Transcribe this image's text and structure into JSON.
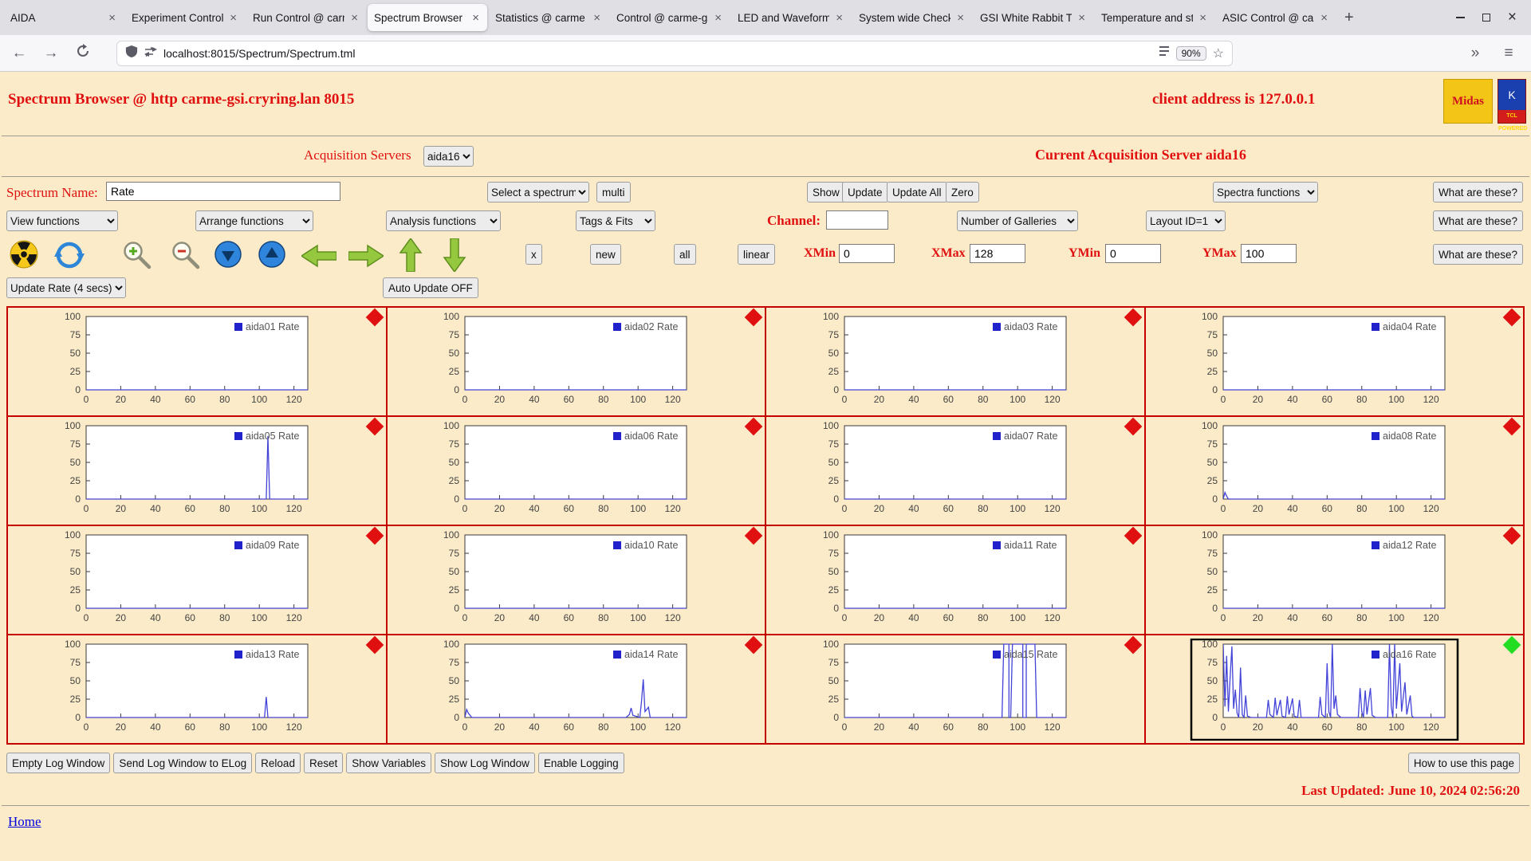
{
  "browser": {
    "tabs": [
      {
        "label": "AIDA",
        "active": false
      },
      {
        "label": "Experiment Control",
        "active": false
      },
      {
        "label": "Run Control @ carm",
        "active": false
      },
      {
        "label": "Spectrum Browser",
        "active": true
      },
      {
        "label": "Statistics @ carme",
        "active": false
      },
      {
        "label": "Control @ carme-gs",
        "active": false
      },
      {
        "label": "LED and Waveform",
        "active": false
      },
      {
        "label": "System wide Check",
        "active": false
      },
      {
        "label": "GSI White Rabbit T",
        "active": false
      },
      {
        "label": "Temperature and st",
        "active": false
      },
      {
        "label": "ASIC Control @ car",
        "active": false
      }
    ],
    "new_tab_button": "+",
    "nav": {
      "back": "←",
      "forward": "→",
      "url": "localhost:8015/Spectrum/Spectrum.tml",
      "zoom_badge": "90%",
      "star": "☆",
      "overflow": "»",
      "menu": "≡"
    }
  },
  "page": {
    "header": {
      "title": "Spectrum Browser @ http carme-gsi.cryring.lan 8015",
      "client_address": "client address is 127.0.0.1",
      "logos": {
        "midas": "Midas",
        "tcl_top": "K",
        "tcl_bottom": "TCL POWERED"
      }
    },
    "acquisition": {
      "servers_label": "Acquisition Servers",
      "server_selected": "aida16",
      "current_server": "Current Acquisition Server aida16"
    },
    "controls": {
      "spectrum_name_label": "Spectrum Name:",
      "spectrum_name_value": "Rate",
      "select_spectrum_option": "Select a spectrum",
      "multi_button": "multi",
      "show_button": "Show",
      "update_button": "Update",
      "update_all_button": "Update All",
      "zero_button": "Zero",
      "spectra_functions_option": "Spectra functions",
      "what_are_these_button": "What are these?",
      "view_functions_option": "View functions",
      "arrange_functions_option": "Arrange functions",
      "analysis_functions_option": "Analysis functions",
      "tags_fits_option": "Tags & Fits",
      "channel_label": "Channel:",
      "channel_value": "",
      "galleries_option": "Number of Galleries",
      "layout_option": "Layout ID=1",
      "x_button": "x",
      "new_button": "new",
      "all_button": "all",
      "linear_button": "linear",
      "xmin_label": "XMin",
      "xmin_value": "0",
      "xmax_label": "XMax",
      "xmax_value": "128",
      "ymin_label": "YMin",
      "ymin_value": "0",
      "ymax_label": "YMax",
      "ymax_value": "100",
      "update_rate_option": "Update Rate (4 secs)",
      "auto_update_button": "Auto Update OFF",
      "icons": [
        "radiation-icon",
        "refresh-icon",
        "zoom-in-icon",
        "zoom-out-icon",
        "scroll-down-icon",
        "scroll-up-icon",
        "pan-left-icon",
        "pan-right-icon",
        "pan-up-icon",
        "pan-down-icon"
      ]
    },
    "footer": {
      "buttons": [
        "Empty Log Window",
        "Send Log Window to ELog",
        "Reload",
        "Reset",
        "Show Variables",
        "Show Log Window",
        "Enable Logging"
      ],
      "help_button": "How to use this page",
      "last_updated": "Last Updated: June 10, 2024 02:56:20",
      "home_link": "Home"
    }
  },
  "chart_data": {
    "type": "line",
    "x_range": [
      0,
      128
    ],
    "y_range": [
      0,
      100
    ],
    "xticks": [
      0,
      20,
      40,
      60,
      80,
      100,
      120
    ],
    "yticks": [
      0,
      25,
      50,
      75,
      100
    ],
    "line_color": "#4343d8",
    "legend_color": "#2222cc",
    "diamond_red": "#e01010",
    "diamond_green": "#22dd22",
    "charts": [
      {
        "name": "aida01 Rate",
        "diamond": "red",
        "selected": false,
        "points": [
          [
            0,
            0
          ],
          [
            128,
            0
          ]
        ]
      },
      {
        "name": "aida02 Rate",
        "diamond": "red",
        "selected": false,
        "points": [
          [
            0,
            0
          ],
          [
            128,
            0
          ]
        ]
      },
      {
        "name": "aida03 Rate",
        "diamond": "red",
        "selected": false,
        "points": [
          [
            0,
            0
          ],
          [
            128,
            0
          ]
        ]
      },
      {
        "name": "aida04 Rate",
        "diamond": "red",
        "selected": false,
        "points": [
          [
            0,
            0
          ],
          [
            128,
            0
          ]
        ]
      },
      {
        "name": "aida05 Rate",
        "diamond": "red",
        "selected": false,
        "points": [
          [
            0,
            0
          ],
          [
            104,
            0
          ],
          [
            105,
            86
          ],
          [
            106,
            0
          ],
          [
            128,
            0
          ]
        ]
      },
      {
        "name": "aida06 Rate",
        "diamond": "red",
        "selected": false,
        "points": [
          [
            0,
            0
          ],
          [
            128,
            0
          ]
        ]
      },
      {
        "name": "aida07 Rate",
        "diamond": "red",
        "selected": false,
        "points": [
          [
            0,
            0
          ],
          [
            128,
            0
          ]
        ]
      },
      {
        "name": "aida08 Rate",
        "diamond": "red",
        "selected": false,
        "points": [
          [
            0,
            0
          ],
          [
            1,
            9
          ],
          [
            2,
            4
          ],
          [
            3,
            0
          ],
          [
            128,
            0
          ]
        ]
      },
      {
        "name": "aida09 Rate",
        "diamond": "red",
        "selected": false,
        "points": [
          [
            0,
            0
          ],
          [
            128,
            0
          ]
        ]
      },
      {
        "name": "aida10 Rate",
        "diamond": "red",
        "selected": false,
        "points": [
          [
            0,
            0
          ],
          [
            128,
            0
          ]
        ]
      },
      {
        "name": "aida11 Rate",
        "diamond": "red",
        "selected": false,
        "points": [
          [
            0,
            0
          ],
          [
            128,
            0
          ]
        ]
      },
      {
        "name": "aida12 Rate",
        "diamond": "red",
        "selected": false,
        "points": [
          [
            0,
            0
          ],
          [
            128,
            0
          ]
        ]
      },
      {
        "name": "aida13 Rate",
        "diamond": "red",
        "selected": false,
        "points": [
          [
            0,
            0
          ],
          [
            103,
            0
          ],
          [
            104,
            28
          ],
          [
            105,
            0
          ],
          [
            128,
            0
          ]
        ]
      },
      {
        "name": "aida14 Rate",
        "diamond": "red",
        "selected": false,
        "points": [
          [
            0,
            0
          ],
          [
            1,
            11
          ],
          [
            2,
            6
          ],
          [
            4,
            0
          ],
          [
            93,
            0
          ],
          [
            95,
            4
          ],
          [
            96,
            13
          ],
          [
            97,
            3
          ],
          [
            101,
            0
          ],
          [
            102,
            22
          ],
          [
            103,
            52
          ],
          [
            104,
            8
          ],
          [
            106,
            14
          ],
          [
            107,
            0
          ],
          [
            128,
            0
          ]
        ]
      },
      {
        "name": "aida15 Rate",
        "diamond": "red",
        "selected": false,
        "points": [
          [
            0,
            0
          ],
          [
            91,
            0
          ],
          [
            92,
            100
          ],
          [
            95,
            100
          ],
          [
            95,
            0
          ],
          [
            96,
            0
          ],
          [
            97,
            100
          ],
          [
            103,
            100
          ],
          [
            103,
            0
          ],
          [
            105,
            0
          ],
          [
            105,
            100
          ],
          [
            110,
            100
          ],
          [
            111,
            0
          ],
          [
            128,
            0
          ]
        ]
      },
      {
        "name": "aida16 Rate",
        "diamond": "green",
        "selected": true,
        "points": [
          [
            0,
            100
          ],
          [
            1,
            15
          ],
          [
            2,
            84
          ],
          [
            3,
            8
          ],
          [
            4,
            55
          ],
          [
            5,
            97
          ],
          [
            6,
            12
          ],
          [
            7,
            38
          ],
          [
            8,
            6
          ],
          [
            9,
            0
          ],
          [
            10,
            68
          ],
          [
            11,
            4
          ],
          [
            12,
            0
          ],
          [
            13,
            30
          ],
          [
            14,
            2
          ],
          [
            16,
            0
          ],
          [
            25,
            0
          ],
          [
            26,
            24
          ],
          [
            27,
            4
          ],
          [
            29,
            0
          ],
          [
            30,
            27
          ],
          [
            31,
            3
          ],
          [
            33,
            24
          ],
          [
            34,
            2
          ],
          [
            36,
            0
          ],
          [
            37,
            29
          ],
          [
            38,
            4
          ],
          [
            40,
            26
          ],
          [
            41,
            2
          ],
          [
            43,
            0
          ],
          [
            44,
            24
          ],
          [
            45,
            0
          ],
          [
            55,
            0
          ],
          [
            56,
            28
          ],
          [
            57,
            4
          ],
          [
            59,
            0
          ],
          [
            60,
            74
          ],
          [
            61,
            8
          ],
          [
            62,
            0
          ],
          [
            63,
            100
          ],
          [
            64,
            12
          ],
          [
            65,
            30
          ],
          [
            66,
            4
          ],
          [
            68,
            0
          ],
          [
            78,
            0
          ],
          [
            79,
            40
          ],
          [
            80,
            8
          ],
          [
            81,
            0
          ],
          [
            82,
            37
          ],
          [
            83,
            4
          ],
          [
            85,
            40
          ],
          [
            86,
            3
          ],
          [
            88,
            0
          ],
          [
            95,
            0
          ],
          [
            96,
            100
          ],
          [
            97,
            15
          ],
          [
            98,
            0
          ],
          [
            99,
            100
          ],
          [
            100,
            12
          ],
          [
            102,
            74
          ],
          [
            103,
            8
          ],
          [
            105,
            48
          ],
          [
            106,
            4
          ],
          [
            108,
            30
          ],
          [
            109,
            2
          ],
          [
            110,
            0
          ],
          [
            128,
            0
          ]
        ]
      }
    ]
  }
}
